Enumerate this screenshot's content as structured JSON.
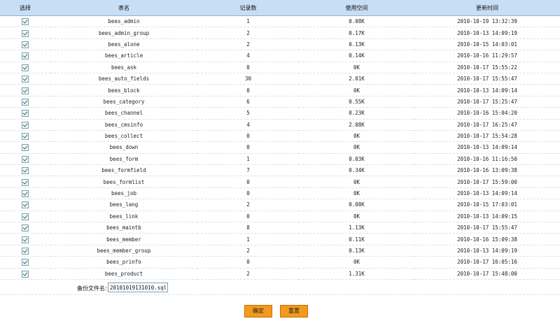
{
  "headers": {
    "select": "选择",
    "table_name": "表名",
    "record_count": "记录数",
    "space_used": "使用空间",
    "update_time": "更新时间"
  },
  "rows": [
    {
      "name": "bees_admin",
      "count": "1",
      "size": "0.08K",
      "time": "2010-10-19 13:32:39"
    },
    {
      "name": "bees_admin_group",
      "count": "2",
      "size": "0.17K",
      "time": "2010-10-13 14:09:19"
    },
    {
      "name": "bees_alone",
      "count": "2",
      "size": "0.13K",
      "time": "2010-10-15 14:03:01"
    },
    {
      "name": "bees_article",
      "count": "4",
      "size": "0.14K",
      "time": "2010-10-16 11:29:57"
    },
    {
      "name": "bees_ask",
      "count": "0",
      "size": "0K",
      "time": "2010-10-17 15:55:22"
    },
    {
      "name": "bees_auto_fields",
      "count": "30",
      "size": "2.01K",
      "time": "2010-10-17 15:55:47"
    },
    {
      "name": "bees_block",
      "count": "0",
      "size": "0K",
      "time": "2010-10-13 14:09:14"
    },
    {
      "name": "bees_category",
      "count": "6",
      "size": "0.55K",
      "time": "2010-10-17 15:25:47"
    },
    {
      "name": "bees_channel",
      "count": "5",
      "size": "0.23K",
      "time": "2010-10-16 15:04:20"
    },
    {
      "name": "bees_cmsinfo",
      "count": "4",
      "size": "2.08K",
      "time": "2010-10-17 16:25:47"
    },
    {
      "name": "bees_collect",
      "count": "0",
      "size": "0K",
      "time": "2010-10-17 15:54:28"
    },
    {
      "name": "bees_down",
      "count": "0",
      "size": "0K",
      "time": "2010-10-13 14:09:14"
    },
    {
      "name": "bees_form",
      "count": "1",
      "size": "0.03K",
      "time": "2010-10-16 11:16:50"
    },
    {
      "name": "bees_formfield",
      "count": "7",
      "size": "0.34K",
      "time": "2010-10-16 13:09:38"
    },
    {
      "name": "bees_formlist",
      "count": "0",
      "size": "0K",
      "time": "2010-10-17 15:59:00"
    },
    {
      "name": "bees_job",
      "count": "0",
      "size": "0K",
      "time": "2010-10-13 14:09:14"
    },
    {
      "name": "bees_lang",
      "count": "2",
      "size": "0.08K",
      "time": "2010-10-15 17:03:01"
    },
    {
      "name": "bees_link",
      "count": "0",
      "size": "0K",
      "time": "2010-10-13 14:09:15"
    },
    {
      "name": "bees_maintb",
      "count": "8",
      "size": "1.13K",
      "time": "2010-10-17 15:55:47"
    },
    {
      "name": "bees_member",
      "count": "1",
      "size": "0.11K",
      "time": "2010-10-16 15:09:38"
    },
    {
      "name": "bees_member_group",
      "count": "2",
      "size": "0.13K",
      "time": "2010-10-13 14:09:19"
    },
    {
      "name": "bees_prinfo",
      "count": "0",
      "size": "0K",
      "time": "2010-10-17 16:05:16"
    },
    {
      "name": "bees_product",
      "count": "2",
      "size": "1.31K",
      "time": "2010-10-17 15:48:00"
    }
  ],
  "backup": {
    "label": "备份文件名:",
    "value": "20101019131010.sql"
  },
  "buttons": {
    "confirm": "确定",
    "reset": "重置"
  },
  "colors": {
    "header_bg": "#c7def4",
    "button_bg": "#f39a1e",
    "check": "#2a7a2a"
  }
}
